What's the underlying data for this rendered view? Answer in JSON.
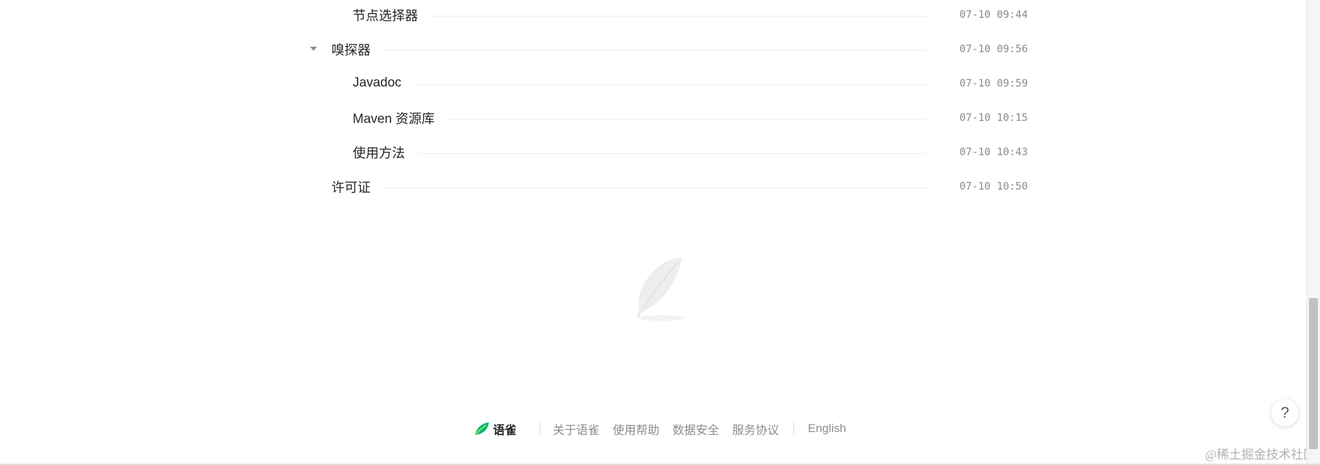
{
  "toc": [
    {
      "title": "节点选择器",
      "time": "07-10 09:44",
      "level": 2,
      "expanded": null
    },
    {
      "title": "嗅探器",
      "time": "07-10 09:56",
      "level": 1,
      "expanded": true
    },
    {
      "title": "Javadoc",
      "time": "07-10 09:59",
      "level": 2,
      "expanded": null
    },
    {
      "title": "Maven 资源库",
      "time": "07-10 10:15",
      "level": 2,
      "expanded": null
    },
    {
      "title": "使用方法",
      "time": "07-10 10:43",
      "level": 2,
      "expanded": null
    },
    {
      "title": "许可证",
      "time": "07-10 10:50",
      "level": 1,
      "expanded": null
    }
  ],
  "footer": {
    "brand": "语雀",
    "links": [
      "关于语雀",
      "使用帮助",
      "数据安全",
      "服务协议"
    ],
    "language": "English"
  },
  "help_button": "?",
  "watermark": "@稀土掘金技术社区",
  "icons": {
    "caret": "caret-down-icon",
    "feather": "feather-icon",
    "brand_logo": "yuque-logo-icon"
  },
  "colors": {
    "text": "#262626",
    "muted": "#8c8c8c",
    "brand_green": "#00b96b"
  }
}
